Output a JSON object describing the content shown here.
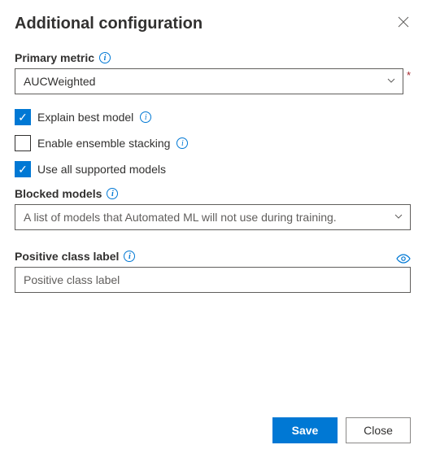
{
  "title": "Additional configuration",
  "primaryMetric": {
    "label": "Primary metric",
    "value": "AUCWeighted",
    "required": true
  },
  "explainBest": {
    "label": "Explain best model",
    "checked": true
  },
  "ensembleStacking": {
    "label": "Enable ensemble stacking",
    "checked": false
  },
  "useAllModels": {
    "label": "Use all supported models",
    "checked": true
  },
  "blockedModels": {
    "label": "Blocked models",
    "placeholder": "A list of models that Automated ML will not use during training."
  },
  "positiveClass": {
    "label": "Positive class label",
    "placeholder": "Positive class label"
  },
  "footer": {
    "save": "Save",
    "close": "Close"
  }
}
